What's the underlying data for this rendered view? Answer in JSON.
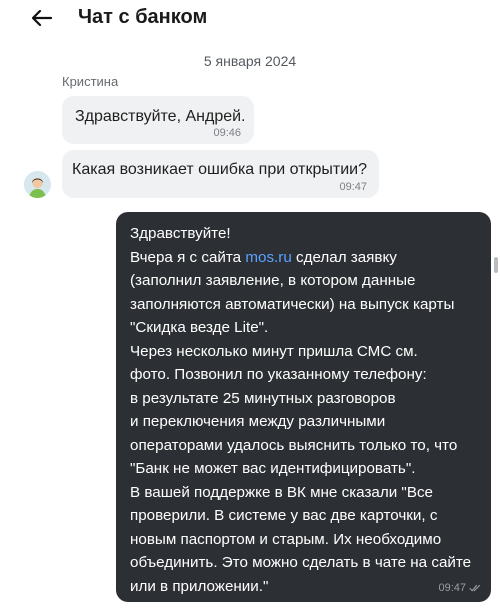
{
  "header": {
    "title": "Чат с банком",
    "back_icon": "arrow-left-icon"
  },
  "chat": {
    "date": "5 января 2024",
    "sender_name": "Кристина",
    "messages": [
      {
        "text": "Здравствуйте, Андрей.",
        "time": "09:46"
      },
      {
        "text": "Какая возникает ошибка при открытии?",
        "time": "09:47"
      }
    ],
    "outgoing": {
      "lines": [
        "Здравствуйте!",
        "Вчера я с сайта ",
        "mos.ru",
        " сделал заявку",
        "(заполнил заявление, в котором данные",
        "заполняются автоматически) на выпуск карты",
        "\"Скидка везде Lite\".",
        "Через несколько минут пришла СМС см.",
        "фото. Позвонил по указанному телефону:",
        "в результате 25 минутных разговоров",
        "и переключения между различными",
        "операторами удалось выяснить только то, что",
        "\"Банк не может вас идентифицировать\".",
        "В вашей поддержке в ВК мне сказали \"Все",
        "проверили. В системе у вас две карточки, с",
        "новым паспортом и старым. Их необходимо",
        "объединить. Это можно сделать в чате на сайте",
        "или в приложении.\""
      ],
      "time": "09:47",
      "status_icon": "double-check-icon"
    }
  },
  "colors": {
    "outgoing_bg": "#2c2f33",
    "incoming_bg": "#f0f1f2",
    "link": "#5aa2ff"
  }
}
